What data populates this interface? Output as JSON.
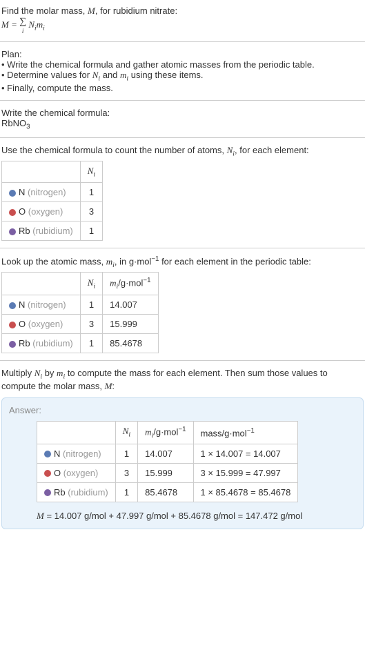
{
  "intro": {
    "line1_prefix": "Find the molar mass, ",
    "line1_var": "M",
    "line1_suffix": ", for rubidium nitrate:",
    "formula_lhs": "M",
    "formula_eq": " = ",
    "formula_sigma": "∑",
    "formula_sub": "i",
    "formula_rhs_n": "N",
    "formula_rhs_m": "m"
  },
  "plan": {
    "title": "Plan:",
    "b1": "• Write the chemical formula and gather atomic masses from the periodic table.",
    "b2_prefix": "• Determine values for ",
    "b2_n": "N",
    "b2_and": " and ",
    "b2_m": "m",
    "b2_suffix": " using these items.",
    "b3": "• Finally, compute the mass."
  },
  "formula_section": {
    "title": "Write the chemical formula:",
    "formula_main": "RbNO",
    "formula_sub": "3"
  },
  "count_section": {
    "text_prefix": "Use the chemical formula to count the number of atoms, ",
    "text_var": "N",
    "text_suffix": ", for each element:",
    "header_n": "N",
    "header_sub": "i",
    "rows": [
      {
        "sym": "N",
        "name": " (nitrogen)",
        "n": "1"
      },
      {
        "sym": "O",
        "name": " (oxygen)",
        "n": "3"
      },
      {
        "sym": "Rb",
        "name": " (rubidium)",
        "n": "1"
      }
    ]
  },
  "mass_section": {
    "text_prefix": "Look up the atomic mass, ",
    "text_var": "m",
    "text_mid": ", in g·mol",
    "text_exp": "−1",
    "text_suffix": " for each element in the periodic table:",
    "header_n": "N",
    "header_m_prefix": "m",
    "header_m_unit": "/g·mol",
    "rows": [
      {
        "sym": "N",
        "name": " (nitrogen)",
        "n": "1",
        "m": "14.007"
      },
      {
        "sym": "O",
        "name": " (oxygen)",
        "n": "3",
        "m": "15.999"
      },
      {
        "sym": "Rb",
        "name": " (rubidium)",
        "n": "1",
        "m": "85.4678"
      }
    ]
  },
  "multiply_section": {
    "text_p1": "Multiply ",
    "text_n": "N",
    "text_by": " by ",
    "text_m": "m",
    "text_p2": " to compute the mass for each element. Then sum those values to compute the molar mass, ",
    "text_mm": "M",
    "text_p3": ":"
  },
  "answer": {
    "label": "Answer:",
    "header_mass": "mass/g·mol",
    "rows": [
      {
        "sym": "N",
        "name": " (nitrogen)",
        "n": "1",
        "m": "14.007",
        "calc": "1 × 14.007 = 14.007"
      },
      {
        "sym": "O",
        "name": " (oxygen)",
        "n": "3",
        "m": "15.999",
        "calc": "3 × 15.999 = 47.997"
      },
      {
        "sym": "Rb",
        "name": " (rubidium)",
        "n": "1",
        "m": "85.4678",
        "calc": "1 × 85.4678 = 85.4678"
      }
    ],
    "final_prefix": "M",
    "final_eq": " = 14.007 g/mol + 47.997 g/mol + 85.4678 g/mol = 147.472 g/mol"
  }
}
